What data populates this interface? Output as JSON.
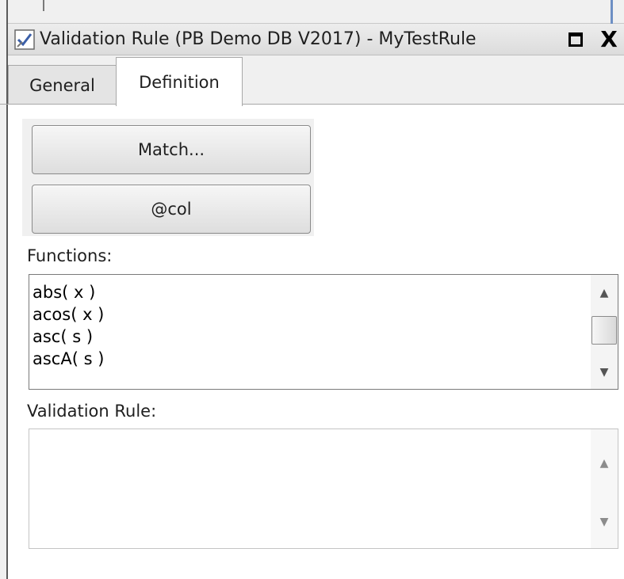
{
  "window": {
    "title": "Validation Rule (PB Demo DB V2017) - MyTestRule",
    "icon": "validation-rule-icon",
    "maximize_icon": "maximize-icon",
    "close_label": "X"
  },
  "tabs": [
    {
      "label": "General",
      "selected": false
    },
    {
      "label": "Definition",
      "selected": true
    }
  ],
  "buttons": {
    "match_label": "Match...",
    "col_label": "@col"
  },
  "functions": {
    "label": "Functions:",
    "items": [
      "abs( x )",
      "acos( x )",
      "asc( s )",
      "ascA( s )"
    ]
  },
  "validation_rule": {
    "label": "Validation Rule:",
    "value": ""
  },
  "colors": {
    "title_bg": "#e4e4e4",
    "button_face": "#e8e8e8",
    "border": "#7a7a7a"
  }
}
